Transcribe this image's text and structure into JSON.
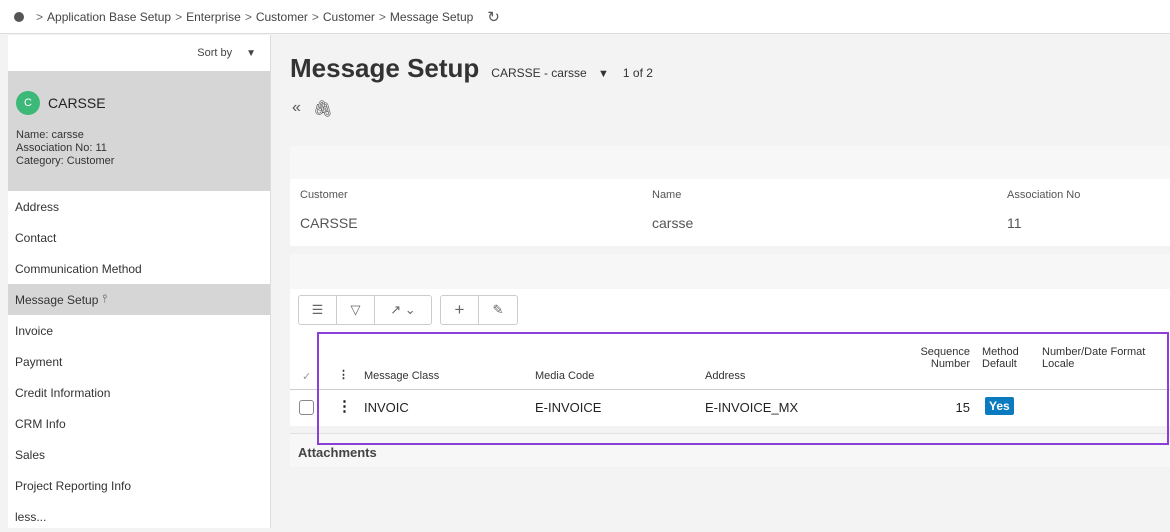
{
  "breadcrumb": [
    "Application Base Setup",
    "Enterprise",
    "Customer",
    "Customer",
    "Message Setup"
  ],
  "sidebar": {
    "sort_label": "Sort by",
    "record": {
      "avatar_letter": "C",
      "title": "CARSSE",
      "name_line": "Name:  carsse",
      "assoc_line": "Association No:  11",
      "category_line": "Category:  Customer"
    },
    "items": [
      {
        "label": "Address"
      },
      {
        "label": "Contact"
      },
      {
        "label": "Communication Method"
      },
      {
        "label": "Message Setup"
      },
      {
        "label": "Invoice"
      },
      {
        "label": "Payment"
      },
      {
        "label": "Credit Information"
      },
      {
        "label": "CRM Info"
      },
      {
        "label": "Sales"
      },
      {
        "label": "Project Reporting Info"
      },
      {
        "label": "less..."
      }
    ]
  },
  "main": {
    "title": "Message Setup",
    "record_selector": "CARSSE - carsse",
    "counter": "1 of 2",
    "fields": {
      "customer_label": "Customer",
      "customer_value": "CARSSE",
      "name_label": "Name",
      "name_value": "carsse",
      "assoc_label": "Association No",
      "assoc_value": "11"
    },
    "grid": {
      "headers": {
        "message_class": "Message Class",
        "media_code": "Media Code",
        "address": "Address",
        "sequence_1": "Sequence",
        "sequence_2": "Number",
        "method_1": "Method",
        "method_2": "Default",
        "locale_1": "Number/Date Format",
        "locale_2": "Locale"
      },
      "rows": [
        {
          "message_class": "INVOIC",
          "media_code": "E-INVOICE",
          "address": "E-INVOICE_MX",
          "sequence": "15",
          "method_default": "Yes",
          "locale": ""
        }
      ]
    },
    "attachments_label": "Attachments"
  },
  "colors": {
    "accent": "#0a7bbf",
    "highlight": "#8b3fd9",
    "avatar": "#3cb878"
  }
}
